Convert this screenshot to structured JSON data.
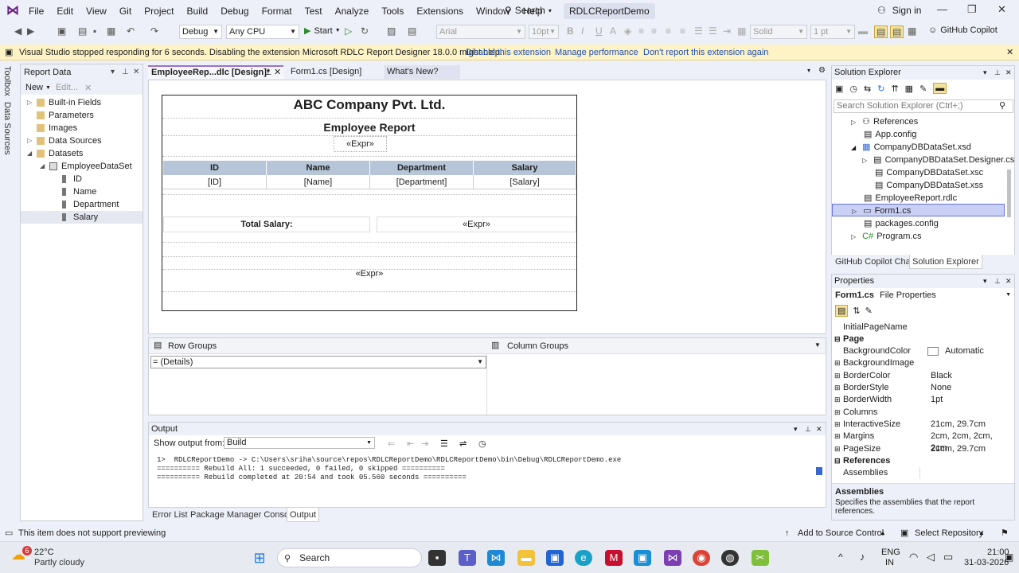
{
  "menubar": {
    "items": [
      "File",
      "Edit",
      "View",
      "Git",
      "Project",
      "Build",
      "Debug",
      "Format",
      "Test",
      "Analyze",
      "Tools",
      "Extensions",
      "Window",
      "Help"
    ],
    "search_label": "Search",
    "solution_name": "RDLCReportDemo",
    "signin": "Sign in"
  },
  "toolbar": {
    "config": "Debug",
    "platform": "Any CPU",
    "start": "Start",
    "font": "Arial",
    "fontsize": "10pt",
    "border_style": "Solid",
    "border_width": "1 pt",
    "copilot": "GitHub Copilot"
  },
  "infobar": {
    "message": "Visual Studio stopped responding for 6 seconds. Disabling the extension Microsoft RDLC Report Designer 18.0.0 might help.",
    "action1": "Disable this extension",
    "action2": "Manage performance",
    "action3": "Don't report this extension again"
  },
  "leftstrip": {
    "toolbox": "Toolbox",
    "datasources": "Data Sources"
  },
  "report_data": {
    "title": "Report Data",
    "new_label": "New",
    "edit_label": "Edit...",
    "items": [
      "Built-in Fields",
      "Parameters",
      "Images",
      "Data Sources",
      "Datasets",
      "EmployeeDataSet",
      "ID",
      "Name",
      "Department",
      "Salary"
    ]
  },
  "doc_tabs": {
    "active": "EmployeeRep...dlc [Design]*",
    "tab2": "Form1.cs [Design]",
    "tab3": "What's New?"
  },
  "report": {
    "company": "ABC Company Pvt. Ltd.",
    "title": "Employee Report",
    "expr": "«Expr»",
    "headers": [
      "ID",
      "Name",
      "Department",
      "Salary"
    ],
    "fields": [
      "[ID]",
      "[Name]",
      "[Department]",
      "[Salary]"
    ],
    "total_label": "Total Salary:"
  },
  "groups": {
    "row_groups": "Row Groups",
    "column_groups": "Column Groups",
    "details": "= (Details)"
  },
  "output": {
    "title": "Output",
    "show_from": "Show output from:",
    "source": "Build",
    "lines": [
      "1>  RDLCReportDemo -> C:\\Users\\sriha\\source\\repos\\RDLCReportDemo\\RDLCReportDemo\\bin\\Debug\\RDLCReportDemo.exe",
      "========== Rebuild All: 1 succeeded, 0 failed, 0 skipped ==========",
      "========== Rebuild completed at 20:54 and took 05.560 seconds =========="
    ],
    "tabs": [
      "Error List",
      "Package Manager Console",
      "Output"
    ]
  },
  "solution_explorer": {
    "title": "Solution Explorer",
    "search_placeholder": "Search Solution Explorer (Ctrl+;)",
    "items": [
      "References",
      "App.config",
      "CompanyDBDataSet.xsd",
      "CompanyDBDataSet.Designer.cs",
      "CompanyDBDataSet.xsc",
      "CompanyDBDataSet.xss",
      "EmployeeReport.rdlc",
      "Form1.cs",
      "packages.config",
      "Program.cs"
    ],
    "tabs": [
      "GitHub Copilot Chat",
      "Solution Explorer"
    ]
  },
  "properties": {
    "title": "Properties",
    "object": "Form1.cs",
    "object_type": "File Properties",
    "rows": [
      {
        "name": "InitialPageName",
        "value": ""
      },
      {
        "name": "Page",
        "value": ""
      },
      {
        "name": "BackgroundColor",
        "value": "Automatic"
      },
      {
        "name": "BackgroundImage",
        "value": ""
      },
      {
        "name": "BorderColor",
        "value": "Black"
      },
      {
        "name": "BorderStyle",
        "value": "None"
      },
      {
        "name": "BorderWidth",
        "value": "1pt"
      },
      {
        "name": "Columns",
        "value": ""
      },
      {
        "name": "InteractiveSize",
        "value": "21cm, 29.7cm"
      },
      {
        "name": "Margins",
        "value": "2cm, 2cm, 2cm, 2cm"
      },
      {
        "name": "PageSize",
        "value": "21cm, 29.7cm"
      },
      {
        "name": "References",
        "value": ""
      },
      {
        "name": "Assemblies",
        "value": ""
      }
    ],
    "desc_title": "Assemblies",
    "desc_text": "Specifies the assemblies that the report references."
  },
  "statusbar": {
    "message": "This item does not support previewing",
    "source_control": "Add to Source Control",
    "repo": "Select Repository"
  },
  "taskbar": {
    "temp": "22°C",
    "weather": "Partly cloudy",
    "badge": "6",
    "search": "Search",
    "lang1": "ENG",
    "lang2": "IN",
    "time": "21:00",
    "date": "31-03-2026"
  },
  "colors": {
    "accent": "#68217a",
    "selection": "#c9cff5",
    "table_header": "#b6c6d8",
    "infobar": "#fdf3c4"
  }
}
